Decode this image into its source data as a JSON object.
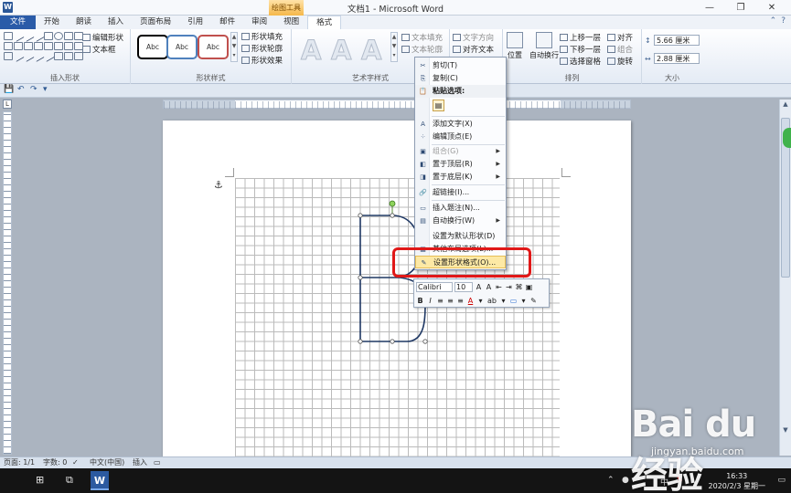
{
  "window": {
    "title": "文档1 - Microsoft Word",
    "app_icon": "W",
    "context_group": "绘图工具",
    "controls": [
      "—",
      "❐",
      "✕"
    ]
  },
  "tabs": [
    {
      "label": "文件"
    },
    {
      "label": "开始"
    },
    {
      "label": "朗读"
    },
    {
      "label": "插入"
    },
    {
      "label": "页面布局"
    },
    {
      "label": "引用"
    },
    {
      "label": "邮件"
    },
    {
      "label": "审阅"
    },
    {
      "label": "视图"
    },
    {
      "label": "格式"
    }
  ],
  "ribbon": {
    "insert_shapes": {
      "label": "插入形状",
      "edit_shape": "编辑形状",
      "text_box": "文本框"
    },
    "shape_styles": {
      "label": "形状样式",
      "sample": "Abc",
      "fill": "形状填充",
      "outline": "形状轮廓",
      "effects": "形状效果"
    },
    "art_styles": {
      "label": "艺术字样式",
      "sample": "A",
      "text_fill": "文本填充",
      "text_outline": "文本轮廓"
    },
    "text": {
      "direction": "文字方向",
      "align": "对齐文本"
    },
    "arrange": {
      "label": "排列",
      "position": "位置",
      "wrap": "自动换行",
      "bring_forward": "上移一层",
      "send_backward": "下移一层",
      "selection_pane": "选择窗格",
      "align": "对齐",
      "group": "组合",
      "rotate": "旋转"
    },
    "size": {
      "label": "大小",
      "height": "5.66 厘米",
      "width": "2.88 厘米"
    }
  },
  "context_menu": {
    "items": [
      {
        "label": "剪切(T)",
        "icon": "scissors-icon",
        "glyph": "✂"
      },
      {
        "label": "复制(C)",
        "icon": "copy-icon",
        "glyph": "⎘"
      },
      {
        "label": "粘贴选项:",
        "icon": "paste-icon",
        "glyph": "📋"
      },
      {
        "label": "添加文字(X)",
        "icon": "text-icon",
        "glyph": "A"
      },
      {
        "label": "编辑顶点(E)",
        "icon": "points-icon",
        "glyph": "⁘"
      },
      {
        "label": "组合(G)",
        "icon": "group-icon",
        "glyph": "▣"
      },
      {
        "label": "置于顶层(R)",
        "icon": "front-icon",
        "glyph": "◧"
      },
      {
        "label": "置于底层(K)",
        "icon": "back-icon",
        "glyph": "◨"
      },
      {
        "label": "超链接(I)...",
        "icon": "link-icon",
        "glyph": "🔗"
      },
      {
        "label": "插入题注(N)...",
        "icon": "caption-icon",
        "glyph": "▭"
      },
      {
        "label": "自动换行(W)",
        "icon": "wrap-icon",
        "glyph": "▤"
      },
      {
        "label": "设置为默认形状(D)",
        "icon": "",
        "glyph": ""
      },
      {
        "label": "其他布局选项(L)...",
        "icon": "layout-icon",
        "glyph": "▦"
      },
      {
        "label": "设置形状格式(O)...",
        "icon": "format-shape-icon",
        "glyph": "✎"
      }
    ]
  },
  "mini_toolbar": {
    "font": "Calibri",
    "size": "10",
    "row2": [
      "B",
      "I",
      "≡",
      "≡",
      "≡",
      "A",
      "▾",
      "ab",
      "▾",
      "▭",
      "▾",
      "✎"
    ]
  },
  "status": {
    "page": "页面: 1/1",
    "words": "字数: 0",
    "language": "中文(中国)",
    "mode": "插入"
  },
  "taskbar": {
    "time": "16:33",
    "date": "2020/2/3 星期一",
    "ime": "中",
    "tray_s": "S"
  },
  "watermark": {
    "logo": "Bai du 经验",
    "url": "jingyan.baidu.com"
  },
  "colors": {
    "file_tab": "#2a5ba8",
    "highlight_red": "#e01818",
    "menu_hover": "#fde9a5",
    "shape_stroke": "#1f3864"
  }
}
